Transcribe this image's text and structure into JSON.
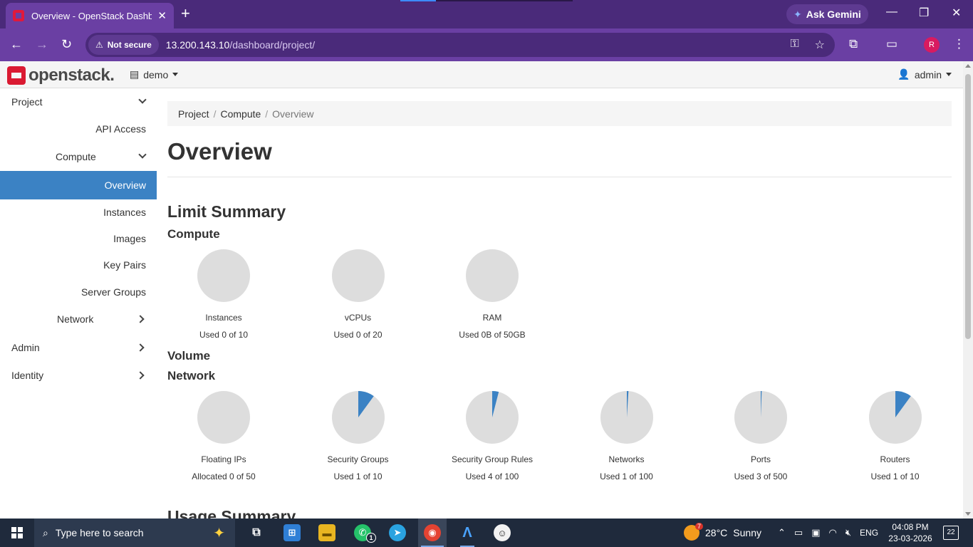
{
  "browser": {
    "tab_title": "Overview - OpenStack Dashboard",
    "gemini_label": "Ask Gemini",
    "security_label": "Not secure",
    "url_host": "13.200.143.10",
    "url_path": "/dashboard/project/",
    "profile_initial": "R"
  },
  "header": {
    "logo_text": "openstack.",
    "project": "demo",
    "user": "admin"
  },
  "sidebar": {
    "items": [
      {
        "label": "Project"
      },
      {
        "label": "API Access"
      },
      {
        "label": "Compute"
      },
      {
        "label": "Overview"
      },
      {
        "label": "Instances"
      },
      {
        "label": "Images"
      },
      {
        "label": "Key Pairs"
      },
      {
        "label": "Server Groups"
      },
      {
        "label": "Network"
      },
      {
        "label": "Admin"
      },
      {
        "label": "Identity"
      }
    ]
  },
  "breadcrumb": [
    "Project",
    "Compute",
    "Overview"
  ],
  "page_title": "Overview",
  "limit_summary": {
    "title": "Limit Summary",
    "compute_title": "Compute",
    "volume_title": "Volume",
    "network_title": "Network",
    "compute": [
      {
        "label": "Instances",
        "used_text": "Used 0 of 10",
        "fraction": 0
      },
      {
        "label": "vCPUs",
        "used_text": "Used 0 of 20",
        "fraction": 0
      },
      {
        "label": "RAM",
        "used_text": "Used 0B of 50GB",
        "fraction": 0
      }
    ],
    "network": [
      {
        "label": "Floating IPs",
        "used_text": "Allocated 0 of 50",
        "fraction": 0
      },
      {
        "label": "Security Groups",
        "used_text": "Used 1 of 10",
        "fraction": 0.1
      },
      {
        "label": "Security Group Rules",
        "used_text": "Used 4 of 100",
        "fraction": 0.04
      },
      {
        "label": "Networks",
        "used_text": "Used 1 of 100",
        "fraction": 0.01
      },
      {
        "label": "Ports",
        "used_text": "Used 3 of 500",
        "fraction": 0.006
      },
      {
        "label": "Routers",
        "used_text": "Used 1 of 10",
        "fraction": 0.1
      }
    ]
  },
  "usage_summary_title": "Usage Summary",
  "colors": {
    "pie_empty": "#dddddd",
    "pie_used": "#3b82c4",
    "active_nav": "#3b82c4",
    "browser_frame": "#6a3fa3"
  },
  "taskbar": {
    "search_placeholder": "Type here to search",
    "weather_temp": "28°C",
    "weather_desc": "Sunny",
    "language": "ENG",
    "time": "04:08 PM",
    "date": "23-03-2026",
    "notifications": "22",
    "whatsapp_badge": "1",
    "weather_badge": "7"
  }
}
